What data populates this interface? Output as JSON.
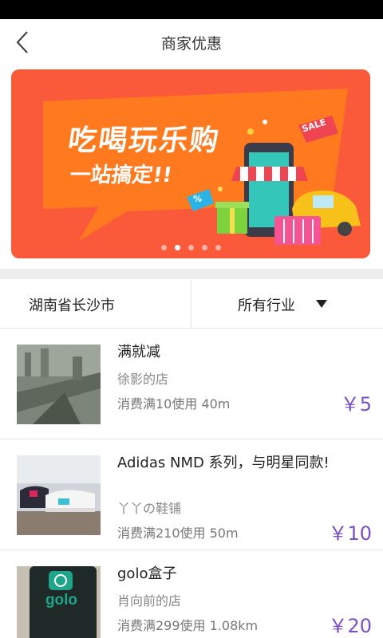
{
  "header": {
    "title": "商家优惠"
  },
  "banner": {
    "headline": "吃喝玩乐购",
    "subline": "一站搞定!!",
    "sale_tag": "SALE",
    "percent_tag": "%",
    "active_dot": 1,
    "dot_count": 5,
    "colors": {
      "background": "#fb5a3a",
      "bubble": "#ff7a1f"
    }
  },
  "filters": {
    "location": "湖南省长沙市",
    "industry": "所有行业"
  },
  "items": [
    {
      "title": "满就减",
      "shop": "徐影的店",
      "condition": "消费满10使用 40m",
      "price": "￥5"
    },
    {
      "title": "Adidas NMD 系列，与明星同款!",
      "shop": "丫丫の鞋铺",
      "condition": "消费满210使用 50m",
      "price": "￥10"
    },
    {
      "title": "golo盒子",
      "shop": "肖向前的店",
      "condition": "消费满299使用 1.08km",
      "price": "￥20",
      "logo_text": "golo"
    }
  ],
  "colors": {
    "price": "#7b4fc7",
    "separator": "#eeeeee"
  }
}
